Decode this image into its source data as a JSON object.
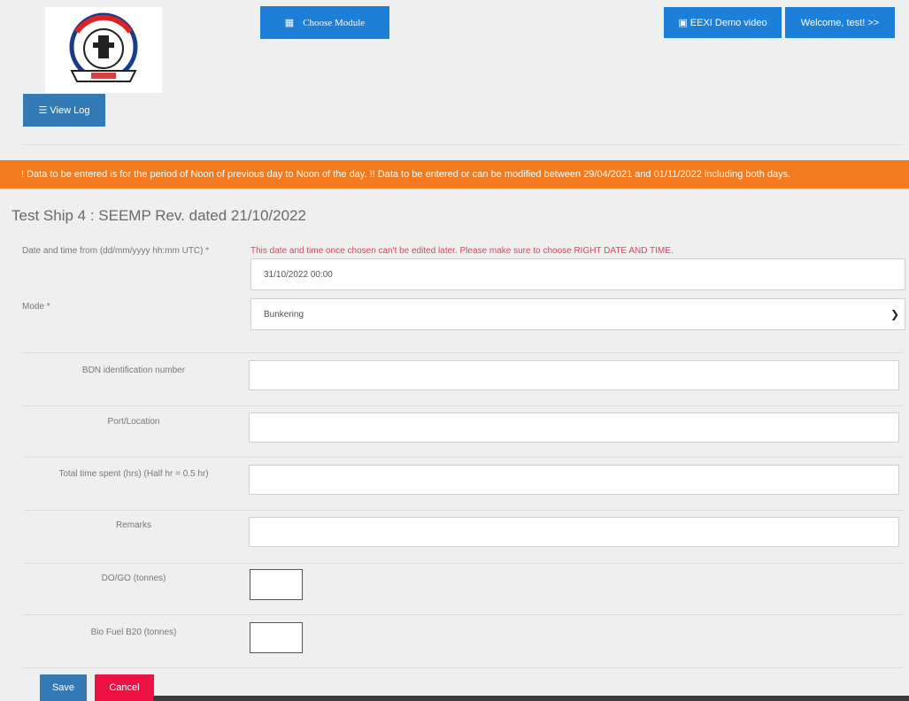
{
  "header": {
    "logo_alt": "Directorate General of Shipping Mumbai logo",
    "choose_module_label": "Choose  Module",
    "eexi_label": "EEXI Demo video",
    "welcome_label": "Welcome, test! >>",
    "view_log_label": "View Log"
  },
  "banner": {
    "text": "! Data to be entered is for the period of Noon of previous day to Noon of the day. !! Data to be entered or can be modified between 29/04/2021 and 01/11/2022 including both days."
  },
  "page_title": "Test Ship 4 : SEEMP Rev. dated 21/10/2022",
  "form": {
    "datetime_label": "Date and time from (dd/mm/yyyy hh:mm UTC) *",
    "datetime_warning": "This date and time once chosen can't be edited later. Please make sure to choose RIGHT DATE AND TIME.",
    "datetime_value": "31/10/2022 00:00",
    "mode_label": "Mode *",
    "mode_value": "Bunkering",
    "bdn_label": "BDN identification number",
    "port_label": "Port/Location",
    "time_label": "Total time spent (hrs) (Half hr = 0.5 hr)",
    "remarks_label": "Remarks",
    "dogo_label": "DO/GO (tonnes)",
    "bio_label": "Bio Fuel B20 (tonnes)",
    "save_label": "Save",
    "cancel_label": "Cancel"
  },
  "icons": {
    "module": "grid-icon",
    "eexi": "film-icon",
    "viewlog": "list-icon",
    "mode_dropdown": "chevron-down-icon"
  },
  "colors": {
    "primary_blue": "#1e7fd6",
    "steel_blue": "#337ab7",
    "banner_orange": "#f47a1f",
    "warning_text": "#e03f5c",
    "cancel_red": "#ee1144"
  }
}
